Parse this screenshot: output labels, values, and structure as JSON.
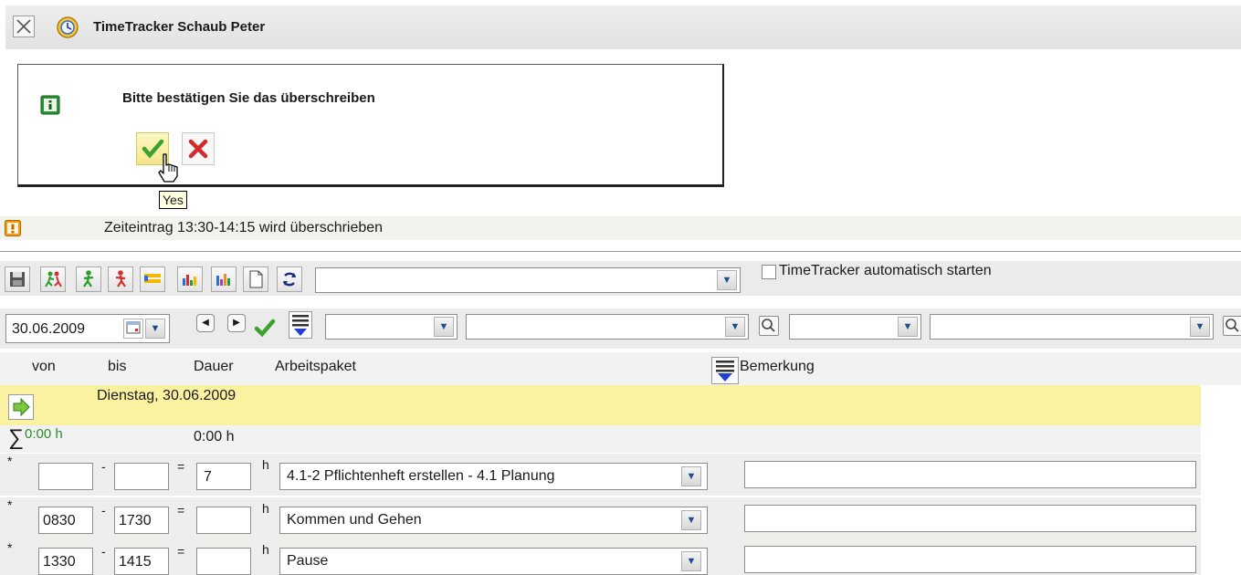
{
  "window": {
    "title": "TimeTracker Schaub Peter"
  },
  "dialog": {
    "message": "Bitte bestätigen Sie das überschreiben",
    "tooltip": "Yes"
  },
  "warning": {
    "text": "Zeiteintrag 13:30-14:15 wird überschrieben"
  },
  "toolbar": {
    "buttons": [
      "save-icon",
      "kommen-gehen-icon",
      "arrive-icon",
      "leave-icon",
      "timeline-icon",
      "chart-icon",
      "chart-color-icon",
      "document-icon",
      "refresh-icon"
    ],
    "main_select_value": "",
    "autostart_label": "TimeTracker automatisch starten",
    "autostart_checked": false
  },
  "filter": {
    "date": "30.06.2009"
  },
  "columns": {
    "von": "von",
    "bis": "bis",
    "dauer": "Dauer",
    "arbeitspaket": "Arbeitspaket",
    "bemerkung": "Bemerkung"
  },
  "day": {
    "label": "Dienstag, 30.06.2009"
  },
  "sum": {
    "total": "0:00 h",
    "dauer": "0:00 h"
  },
  "entries": [
    {
      "marker": "*",
      "von": "",
      "bis": "",
      "dauer": "7",
      "unit": "h",
      "arbeitspaket": "4.1-2 Pflichtenheft erstellen - 4.1 Planung",
      "bemerkung": ""
    },
    {
      "marker": "*",
      "von": "0830",
      "bis": "1730",
      "dauer": "",
      "unit": "h",
      "arbeitspaket": "Kommen und Gehen",
      "bemerkung": ""
    },
    {
      "marker": "*",
      "von": "1330",
      "bis": "1415",
      "dauer": "",
      "unit": "h",
      "arbeitspaket": "Pause",
      "bemerkung": ""
    }
  ],
  "colors": {
    "day_row": "#faf2a0",
    "sum_green": "#2e8b2e",
    "warning_orange": "#f29a16"
  }
}
